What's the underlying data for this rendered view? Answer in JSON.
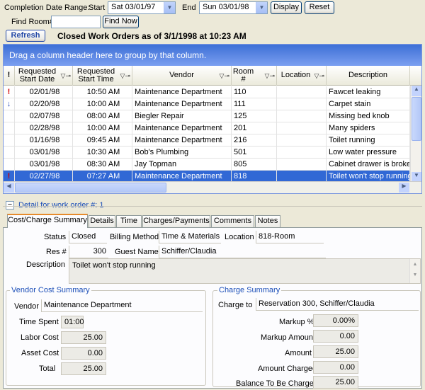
{
  "toolbar": {
    "range_label": "Completion Date Range:",
    "start_label": "Start",
    "start_value": "Sat 03/01/97",
    "end_label": "End",
    "end_value": "Sun 03/01/98",
    "display_label": "Display",
    "reset_label": "Reset",
    "find_room_label": "Find Room#",
    "find_room_value": "",
    "find_now_label": "Find Now",
    "refresh_label": "Refresh",
    "heading": "Closed Work Orders as of 3/1/1998 at 10:23 AM"
  },
  "grid": {
    "group_hint": "Drag a column header here to group by that column.",
    "columns": {
      "priority": "!",
      "start_date": "Requested Start Date",
      "start_time": "Requested Start Time",
      "vendor": "Vendor",
      "room": "Room #",
      "location": "Location",
      "description": "Description"
    },
    "rows": [
      {
        "flag": "!",
        "date": "02/01/98",
        "time": "10:50 AM",
        "vendor": "Maintenance Department",
        "room": "110",
        "location": "",
        "desc": "Fawcet leaking"
      },
      {
        "flag": "↓",
        "date": "02/20/98",
        "time": "10:00 AM",
        "vendor": "Maintenance Department",
        "room": "111",
        "location": "",
        "desc": "Carpet stain"
      },
      {
        "flag": "",
        "date": "02/07/98",
        "time": "08:00 AM",
        "vendor": "Biegler Repair",
        "room": "125",
        "location": "",
        "desc": "Missing bed knob"
      },
      {
        "flag": "",
        "date": "02/28/98",
        "time": "10:00 AM",
        "vendor": "Maintenance Department",
        "room": "201",
        "location": "",
        "desc": "Many spiders"
      },
      {
        "flag": "",
        "date": "01/16/98",
        "time": "09:45 AM",
        "vendor": "Maintenance Department",
        "room": "216",
        "location": "",
        "desc": "Toilet running"
      },
      {
        "flag": "",
        "date": "03/01/98",
        "time": "10:30 AM",
        "vendor": "Bob's Plumbing",
        "room": "501",
        "location": "",
        "desc": "Low water pressure"
      },
      {
        "flag": "",
        "date": "03/01/98",
        "time": "08:30 AM",
        "vendor": "Jay Topman",
        "room": "805",
        "location": "",
        "desc": "Cabinet drawer is broken"
      },
      {
        "flag": "!",
        "date": "02/27/98",
        "time": "07:27 AM",
        "vendor": "Maintenance Department",
        "room": "818",
        "location": "",
        "desc": "Toilet won't stop running"
      }
    ]
  },
  "detail": {
    "header": "Detail for work order #: 1",
    "tabs": [
      "Cost/Charge Summary",
      "Details",
      "Time",
      "Charges/Payments",
      "Comments",
      "Notes"
    ],
    "status_label": "Status",
    "status_value": "Closed",
    "billing_label": "Billing Method",
    "billing_value": "Time & Materials",
    "location_label": "Location",
    "location_value": "818-Room",
    "res_label": "Res #",
    "res_value": "300",
    "guest_label": "Guest Name",
    "guest_value": "Schiffer/Claudia",
    "description_label": "Description",
    "description_value": "Toilet won't stop running"
  },
  "vendor_summary": {
    "title": "Vendor Cost Summary",
    "vendor_label": "Vendor",
    "vendor_value": "Maintenance Department",
    "time_label": "Time Spent",
    "time_value": "01:00",
    "labor_label": "Labor Cost",
    "labor_value": "25.00",
    "asset_label": "Asset Cost",
    "asset_value": "0.00",
    "total_label": "Total",
    "total_value": "25.00"
  },
  "charge_summary": {
    "title": "Charge Summary",
    "charge_to_label": "Charge to",
    "charge_to_value": "Reservation 300, Schiffer/Claudia",
    "markup_pct_label": "Markup %",
    "markup_pct_value": "0.00%",
    "markup_amt_label": "Markup Amount",
    "markup_amt_value": "0.00",
    "amount_label": "Amount",
    "amount_value": "25.00",
    "charged_label": "Amount Charged",
    "charged_value": "0.00",
    "balance_label": "Balance To Be Charged",
    "balance_value": "25.00"
  },
  "colors": {
    "selection": "#3168d5",
    "group_bar": "#5a86e4",
    "flag_red": "#d00000",
    "accent_tab": "#e68b2c"
  }
}
